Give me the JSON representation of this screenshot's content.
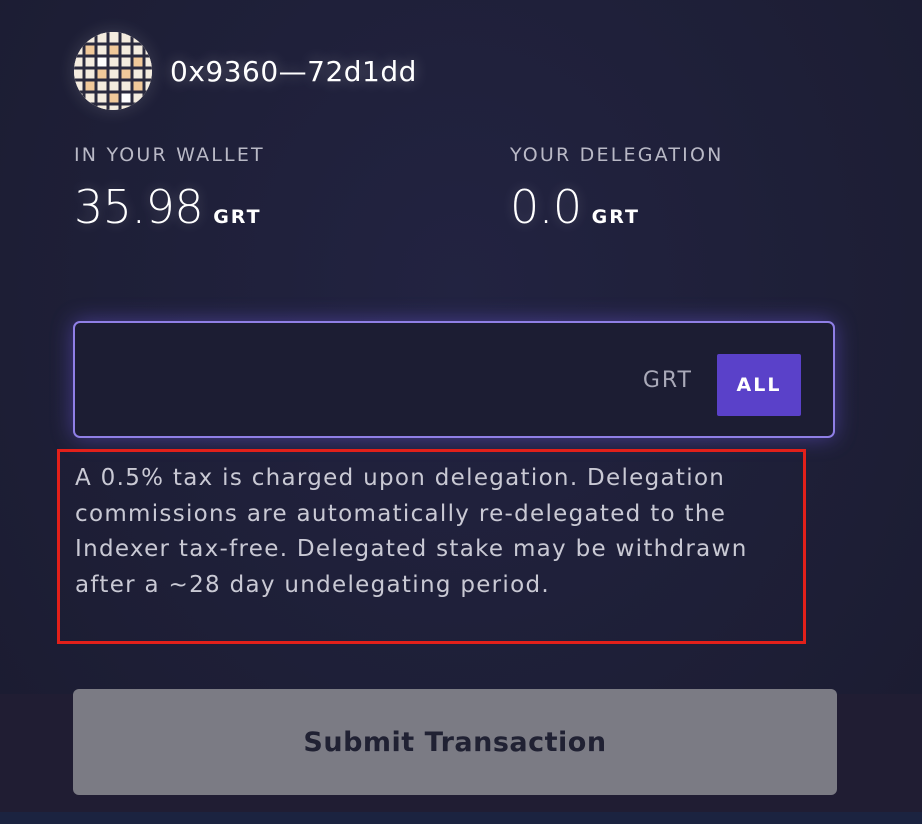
{
  "indexer": {
    "avatar_icon": "indexer-avatar-icon",
    "address": "0x9360—72d1dd"
  },
  "wallet": {
    "label": "IN YOUR WALLET",
    "value": "35.98",
    "unit": "GRT"
  },
  "delegation": {
    "label": "YOUR DELEGATION",
    "value": "0.0",
    "unit": "GRT"
  },
  "amount_input": {
    "value": "",
    "placeholder": "",
    "unit": "GRT",
    "all_label": "ALL"
  },
  "notice": {
    "text": "A 0.5% tax is charged upon delegation. Delegation commissions are automatically re-delegated to the Indexer tax-free. Delegated stake may be withdrawn after a ~28 day undelegating period."
  },
  "submit": {
    "label": "Submit Transaction"
  },
  "colors": {
    "background": "#1e1f36",
    "accent": "#5a41c9",
    "input_border": "#8f7fe6",
    "highlight": "#e2201a",
    "submit_disabled": "#7b7b84"
  }
}
